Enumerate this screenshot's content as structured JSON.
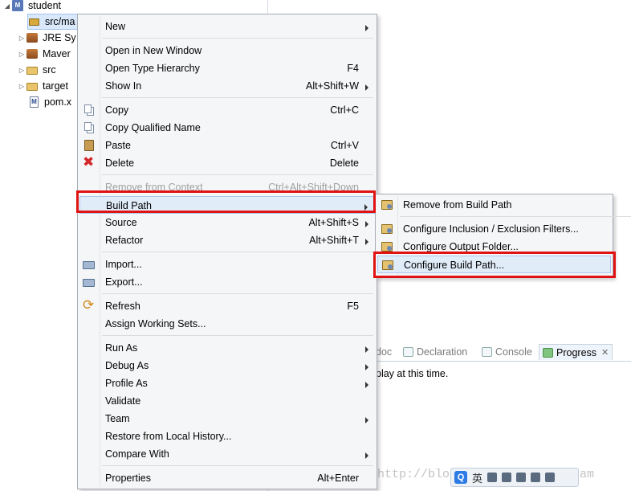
{
  "explorer": {
    "project": "student",
    "items": [
      {
        "label": "src/ma",
        "icon": "package-icon"
      },
      {
        "label": "JRE Sy",
        "icon": "library-icon"
      },
      {
        "label": "Maver",
        "icon": "library-icon"
      },
      {
        "label": "src",
        "icon": "folder-icon"
      },
      {
        "label": "target",
        "icon": "folder-icon"
      },
      {
        "label": "pom.x",
        "icon": "pom-file-icon"
      }
    ]
  },
  "context_menu": {
    "new": "New",
    "open_new_window": "Open in New Window",
    "open_type_hierarchy": "Open Type Hierarchy",
    "open_type_hierarchy_shortcut": "F4",
    "show_in": "Show In",
    "show_in_shortcut": "Alt+Shift+W",
    "copy": "Copy",
    "copy_shortcut": "Ctrl+C",
    "copy_qualified": "Copy Qualified Name",
    "paste": "Paste",
    "paste_shortcut": "Ctrl+V",
    "delete": "Delete",
    "delete_shortcut": "Delete",
    "remove_context": "Remove from Context",
    "remove_context_shortcut": "Ctrl+Alt+Shift+Down",
    "build_path": "Build Path",
    "source": "Source",
    "source_shortcut": "Alt+Shift+S",
    "refactor": "Refactor",
    "refactor_shortcut": "Alt+Shift+T",
    "import": "Import...",
    "export": "Export...",
    "refresh": "Refresh",
    "refresh_shortcut": "F5",
    "assign_working_sets": "Assign Working Sets...",
    "run_as": "Run As",
    "debug_as": "Debug As",
    "profile_as": "Profile As",
    "validate": "Validate",
    "team": "Team",
    "restore_history": "Restore from Local History...",
    "compare_with": "Compare With",
    "properties": "Properties",
    "properties_shortcut": "Alt+Enter"
  },
  "build_path_submenu": {
    "remove": "Remove from Build Path",
    "configure_inclusion": "Configure Inclusion / Exclusion Filters...",
    "configure_output": "Configure Output Folder...",
    "configure_build_path": "Configure Build Path..."
  },
  "views": {
    "tabs": [
      "doc",
      "Declaration",
      "Console",
      "Progress"
    ],
    "close_glyph": "✕",
    "message": "play at this time."
  },
  "watermark": "http://blog.csdn.net/AnnaDream",
  "ime": {
    "char": "英",
    "logo": "Q"
  },
  "colors": {
    "callout": "#e01212",
    "selection": "#e1ecf9"
  }
}
